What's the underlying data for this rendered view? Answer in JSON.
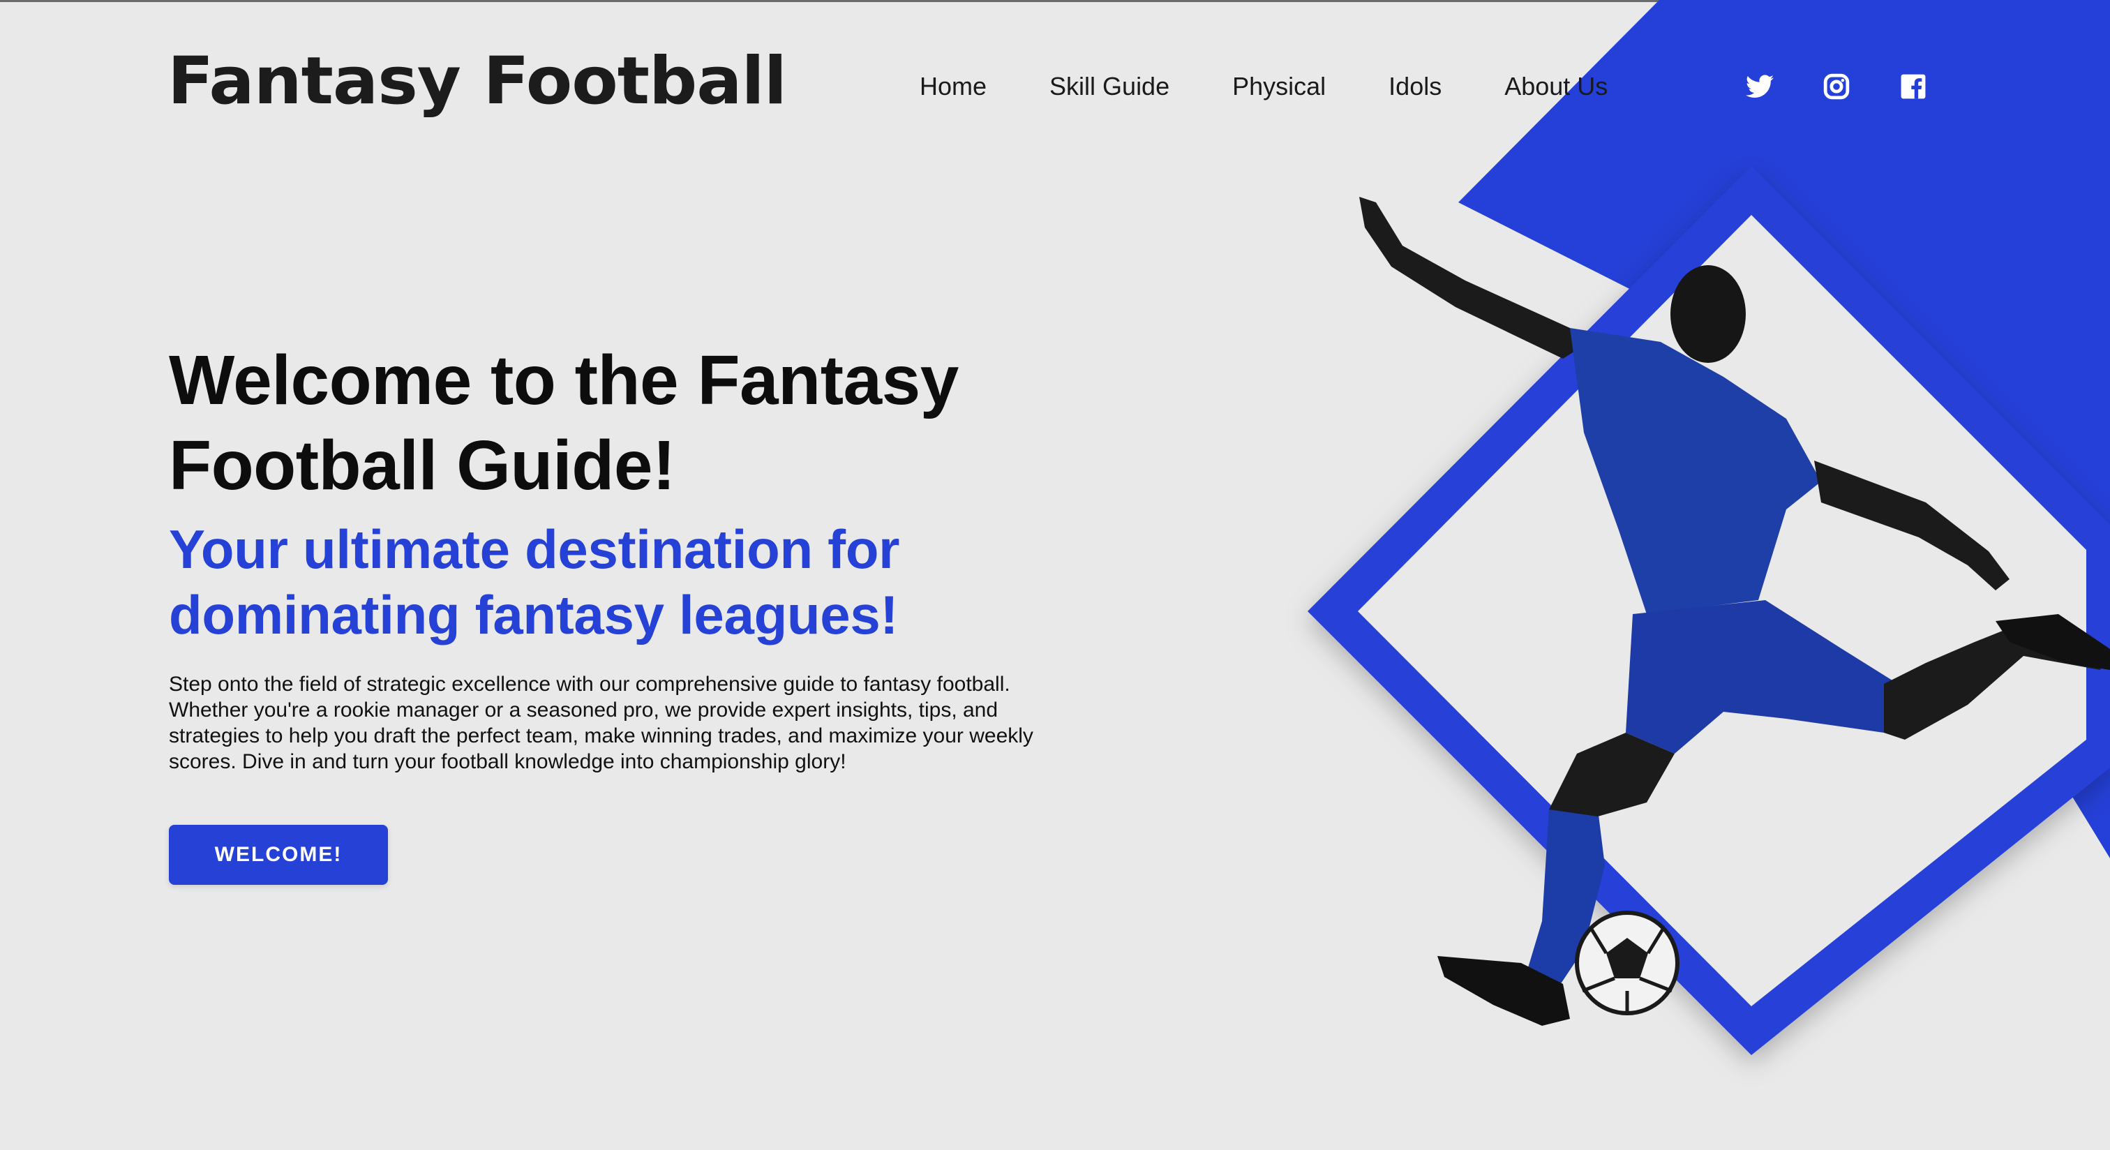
{
  "header": {
    "logo_text": "Fantasy Football",
    "nav": [
      {
        "label": "Home"
      },
      {
        "label": "Skill Guide"
      },
      {
        "label": "Physical"
      },
      {
        "label": "Idols"
      },
      {
        "label": "About Us"
      }
    ],
    "social": [
      {
        "icon": "twitter-icon"
      },
      {
        "icon": "instagram-icon"
      },
      {
        "icon": "facebook-icon"
      }
    ]
  },
  "hero": {
    "title": "Welcome to the Fantasy Football Guide!",
    "subtitle": "Your ultimate destination for dominating fantasy leagues!",
    "body": "Step onto the field of strategic excellence with our comprehensive guide to fantasy football. Whether you're a rookie manager or a seasoned pro, we provide expert insights, tips, and strategies to help you draft the perfect team, make winning trades, and maximize your weekly scores. Dive in and turn your football knowledge into championship glory!",
    "cta_label": "WELCOME!"
  },
  "colors": {
    "accent": "#2541d6",
    "background": "#e9e9ea",
    "text": "#111111"
  }
}
